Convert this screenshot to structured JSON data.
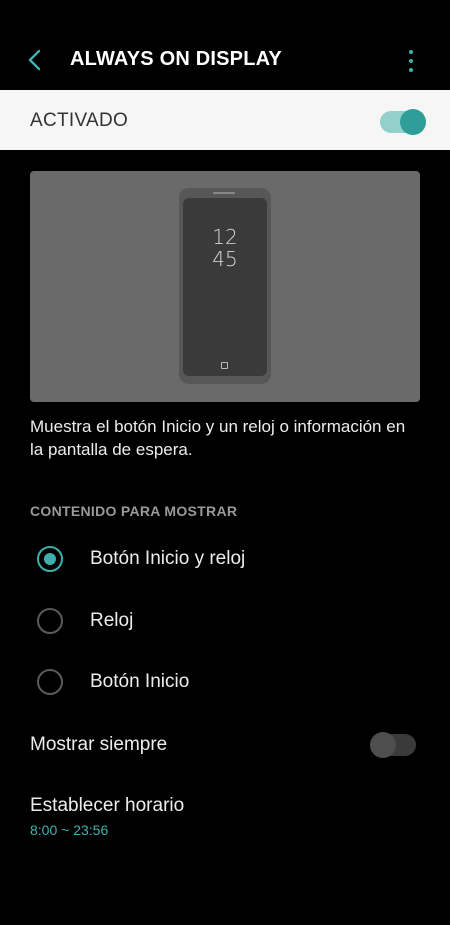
{
  "header": {
    "back_icon": "chevron-left-icon",
    "title": "ALWAYS ON DISPLAY",
    "more_icon": "more-vertical-icon"
  },
  "master": {
    "label": "ACTIVADO",
    "enabled": true
  },
  "preview": {
    "clock_hours": "12",
    "clock_minutes": "45"
  },
  "description": "Muestra el botón Inicio y un reloj o información en la pantalla de espera.",
  "content_section": {
    "title": "CONTENIDO PARA MOSTRAR",
    "options": [
      {
        "label": "Botón Inicio y reloj",
        "selected": true
      },
      {
        "label": "Reloj",
        "selected": false
      },
      {
        "label": "Botón Inicio",
        "selected": false
      }
    ]
  },
  "show_always": {
    "label": "Mostrar siempre",
    "enabled": false
  },
  "schedule": {
    "label": "Establecer horario",
    "value": "8:00 ~ 23:56"
  },
  "colors": {
    "accent": "#3fb0ad",
    "background": "#000000",
    "master_bar": "#f6f6f6"
  }
}
